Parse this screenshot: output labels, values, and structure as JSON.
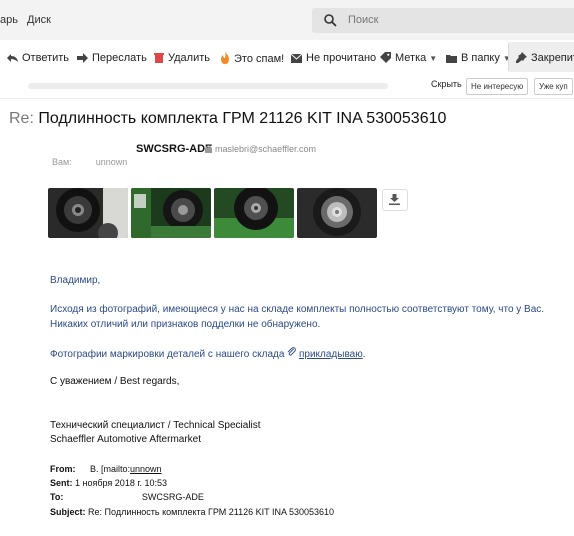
{
  "topbar": {
    "nav_left": "арь",
    "nav_disk": "Диск",
    "search_placeholder": "Поиск"
  },
  "toolbar": {
    "reply": "Ответить",
    "forward": "Переслать",
    "delete": "Удалить",
    "spam": "Это спам!",
    "unread": "Не прочитано",
    "label": "Метка",
    "folder": "В папку",
    "pin": "Закрепить"
  },
  "rowbar": {
    "hide": "Скрыть",
    "not_interested": "Не интересую",
    "already_bought": "Уже куп"
  },
  "message": {
    "subject_prefix": "Re:",
    "subject": "Подлинность комплекта ГРМ 21126 KIT INA 530053610",
    "sender_name": "SWCSRG-ADE",
    "sender_email": "maslebri@schaeffler.com",
    "to_label": "Вам:",
    "to_value": "unnown",
    "greeting": "Владимир,",
    "para1_line1": "Исходя из фотографий, имеющиеся у нас на складе комплекты полностью соответствуют тому, что у Вас.",
    "para1_line2": "Никаких отличий или признаков подделки не обнаружено.",
    "photos_line": "Фотографии маркировки деталей с нашего склада",
    "photos_link": "прикладываю",
    "photos_end": ".",
    "regards": "С уважением / Best regards,",
    "sig_title": "Технический специалист / Technical Specialist",
    "sig_company": "Schaeffler Automotive Aftermarket",
    "quoted": {
      "from_label": "From:",
      "from_value": "В. [mailto:",
      "from_link": "unnown",
      "sent_label": "Sent:",
      "sent_value": "1 ноября 2018 г. 10:53",
      "to_label": "To:",
      "to_value": "SWCSRG-ADE",
      "subject_label": "Subject:",
      "subject_value": "Re: Подлинность комплекта ГРМ 21126 KIT INA 530053610"
    }
  },
  "attachments": [
    {
      "name": "photo-1-icon"
    },
    {
      "name": "photo-2-icon"
    },
    {
      "name": "photo-3-icon"
    },
    {
      "name": "photo-4-icon"
    }
  ],
  "colors": {
    "link_blue": "#2b4a8a",
    "delete_red": "#e04848",
    "spam_orange": "#f08a24"
  }
}
